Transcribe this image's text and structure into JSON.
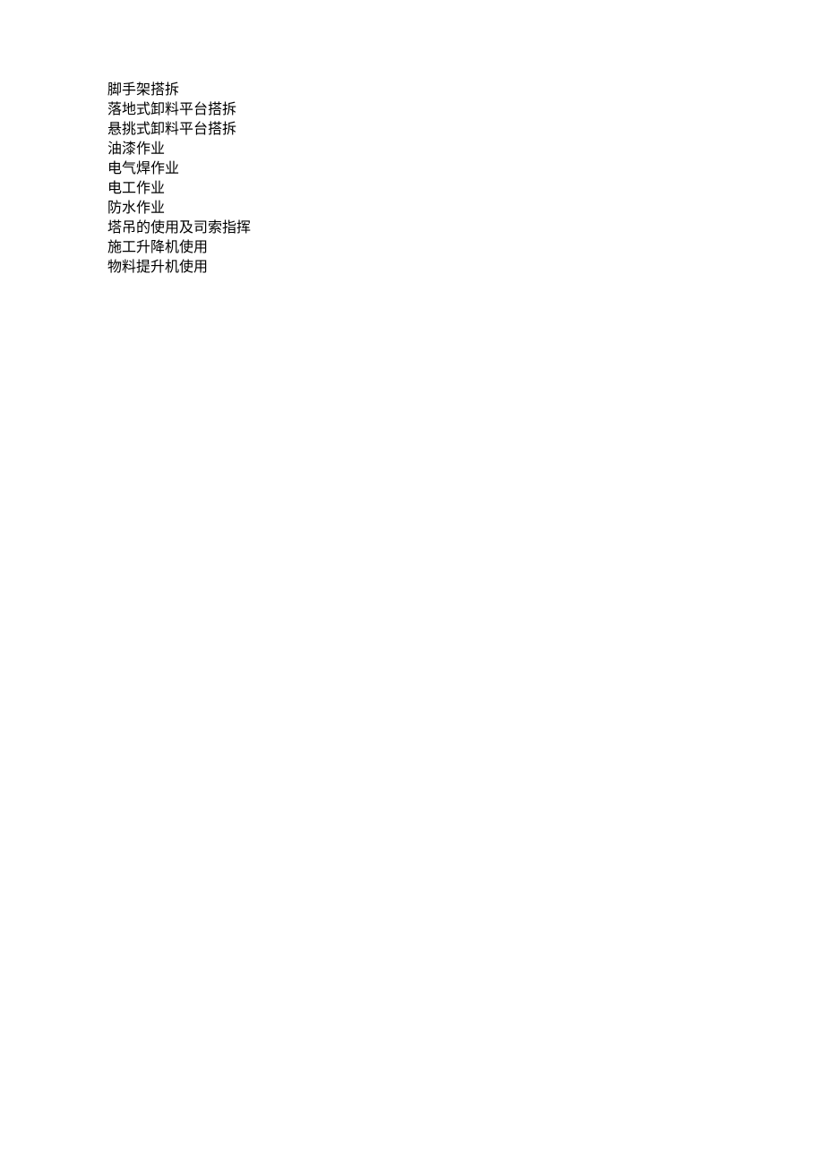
{
  "lines": [
    "脚手架搭拆",
    "落地式卸料平台搭拆",
    "悬挑式卸料平台搭拆",
    "油漆作业",
    "电气焊作业",
    "电工作业",
    "防水作业",
    "塔吊的使用及司索指挥",
    "施工升降机使用",
    "物料提升机使用"
  ]
}
